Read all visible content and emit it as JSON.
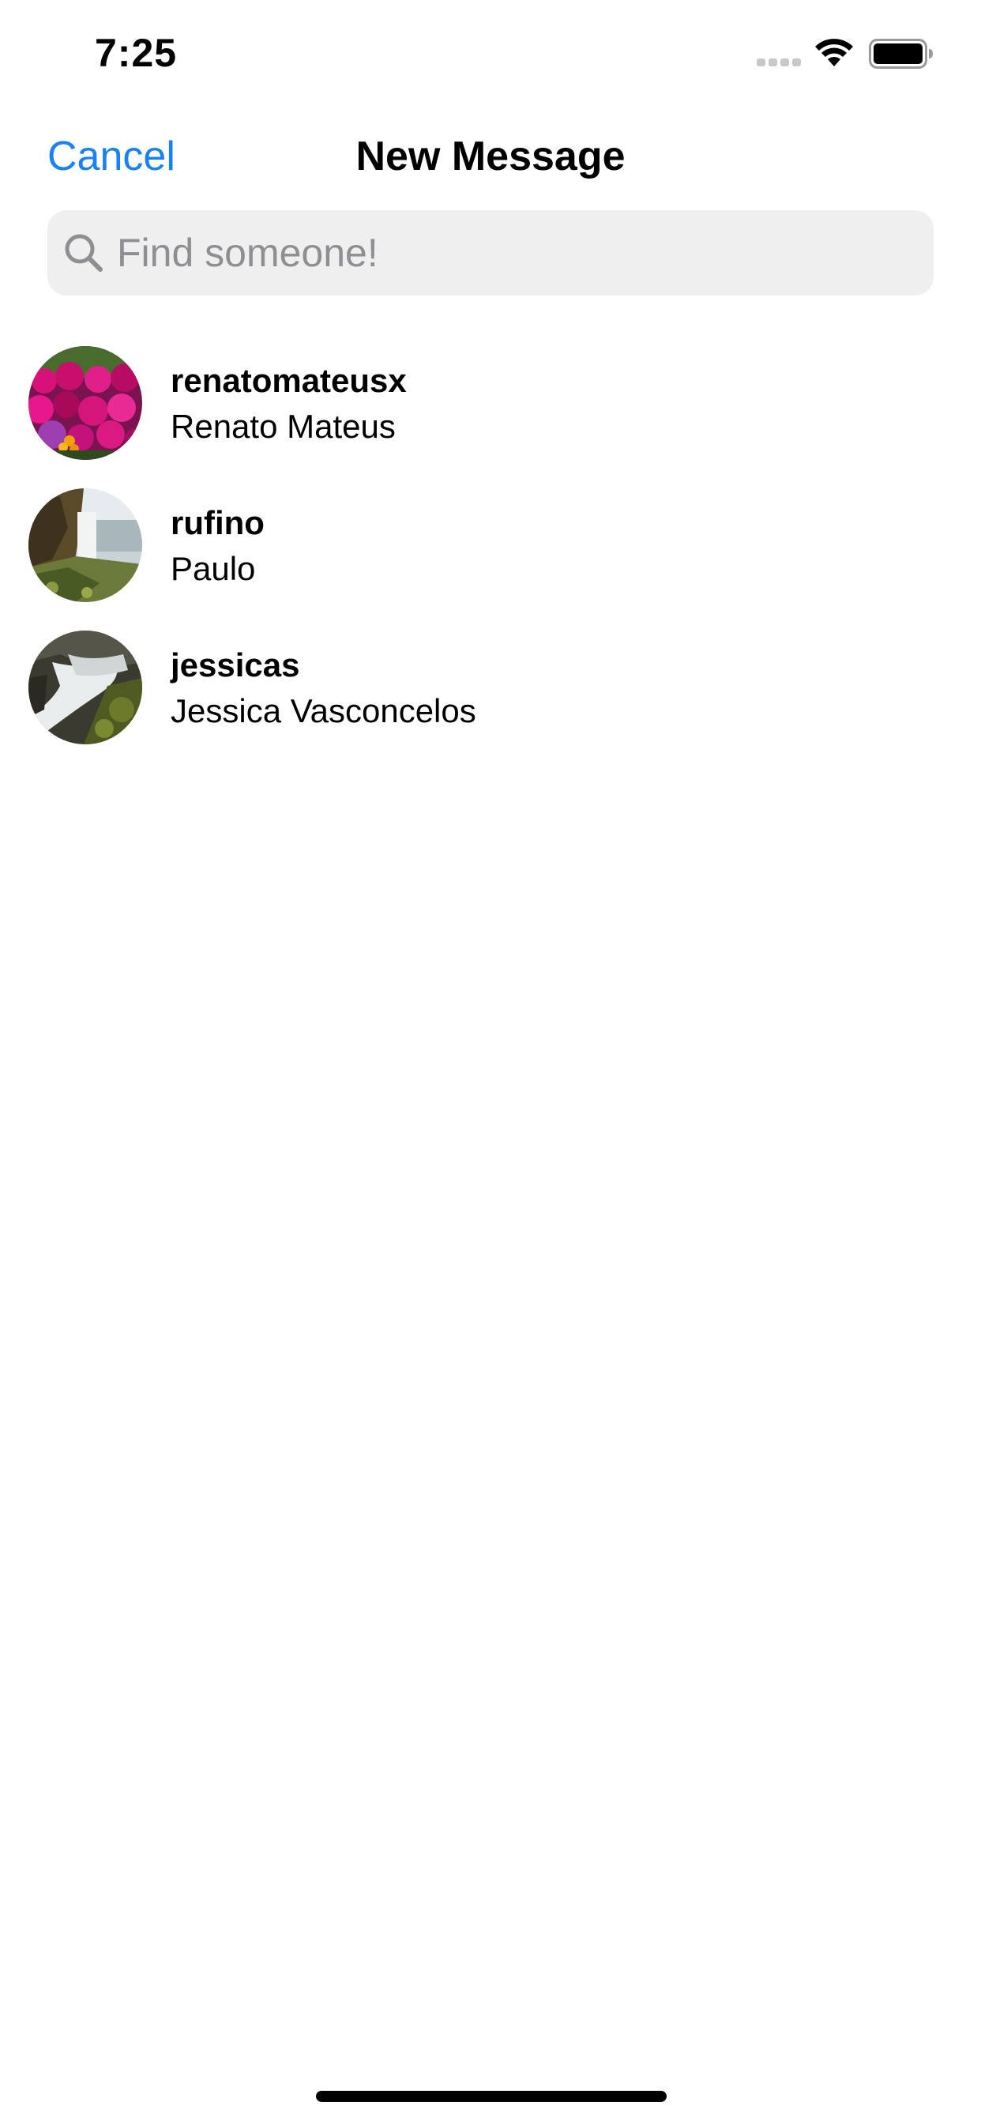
{
  "status_bar": {
    "time": "7:25",
    "signal_icon": "cellular-signal-icon",
    "wifi_icon": "wifi-icon",
    "battery_icon": "battery-full-icon"
  },
  "nav": {
    "cancel_label": "Cancel",
    "title": "New Message"
  },
  "search": {
    "icon": "search-icon",
    "value": "",
    "placeholder": "Find someone!"
  },
  "users": [
    {
      "username": "renatomateusx",
      "full_name": "Renato Mateus",
      "avatar": "flowers-photo-avatar"
    },
    {
      "username": "rufino",
      "full_name": "Paulo",
      "avatar": "waterfall-cliff-photo-avatar"
    },
    {
      "username": "jessicas",
      "full_name": "Jessica Vasconcelos",
      "avatar": "waterfall-stream-photo-avatar"
    }
  ],
  "colors": {
    "accent": "#1a82f0",
    "search_background": "#efefef",
    "placeholder": "#8e8e93"
  }
}
